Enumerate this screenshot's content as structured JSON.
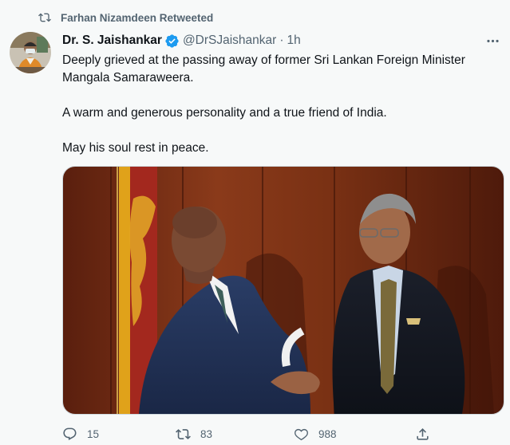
{
  "retweet": {
    "label": "Farhan Nizamdeen Retweeted",
    "icon": "retweet-icon"
  },
  "author": {
    "name": "Dr. S. Jaishankar",
    "handle": "@DrSJaishankar",
    "separator": "·",
    "time": "1h",
    "verified": true
  },
  "tweet": {
    "lines": [
      "Deeply grieved at the passing away of former Sri Lankan Foreign Minister Mangala Samaraweera.",
      "A warm and generous personality and a true friend of India.",
      "May his soul rest in peace."
    ]
  },
  "actions": {
    "reply_count": "15",
    "retweet_count": "83",
    "like_count": "988"
  },
  "colors": {
    "background": "#f7f9f9",
    "text_primary": "#0f1419",
    "text_secondary": "#536471",
    "verified_blue": "#1d9bf0"
  }
}
